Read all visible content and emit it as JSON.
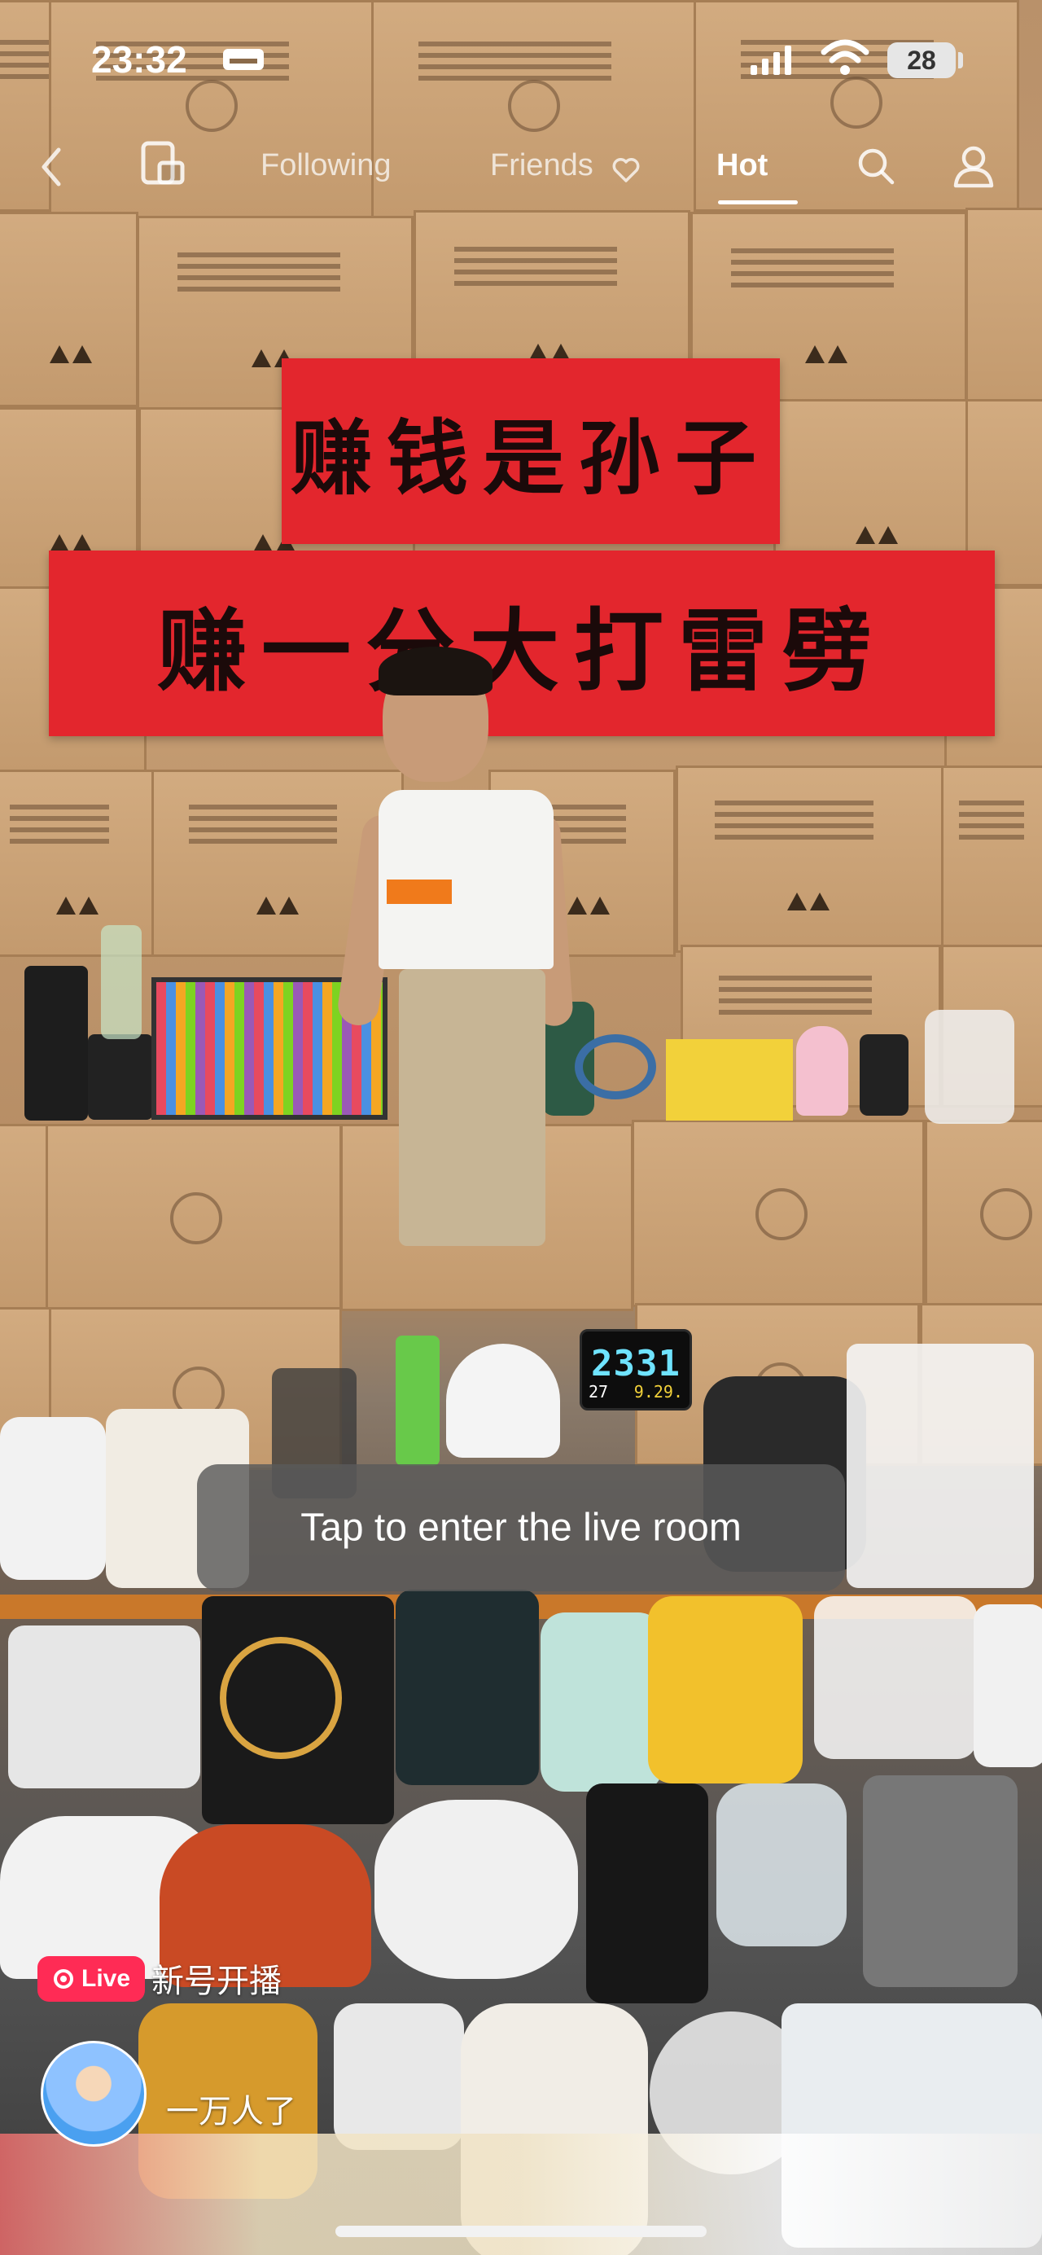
{
  "status_bar": {
    "time": "23:32",
    "battery": "28",
    "icons": [
      "bed-icon",
      "signal-icon",
      "wifi-icon",
      "battery-icon"
    ]
  },
  "top_nav": {
    "tabs": [
      {
        "label": "Following",
        "active": false
      },
      {
        "label": "Friends",
        "active": false
      },
      {
        "label": "Hot",
        "active": true
      }
    ],
    "icons": [
      "back-icon",
      "mini-player-icon",
      "heart-icon",
      "search-icon",
      "profile-icon"
    ]
  },
  "scene": {
    "banner_top": "赚钱是孙子",
    "banner_bottom": "赚一分大打雷劈",
    "clock_time": "2331",
    "clock_temp": "27",
    "clock_date": "9.29."
  },
  "toast": {
    "text": "Tap to enter the live room"
  },
  "live": {
    "badge_label": "Live",
    "title": "新号开播",
    "viewer_text": "一万人了"
  },
  "colors": {
    "live_accent": "#ff2b55",
    "banner_red": "#e3262d",
    "clock_digits": "#6fe3ff"
  }
}
